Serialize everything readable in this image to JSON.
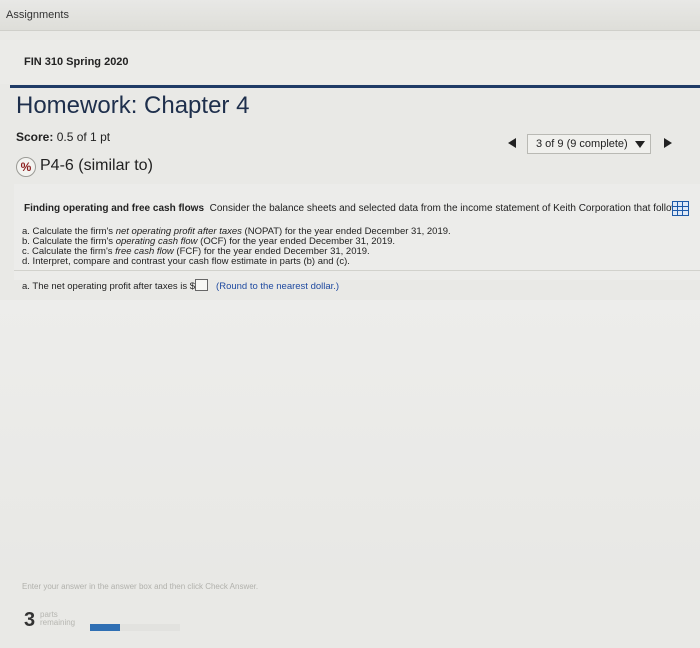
{
  "window": {
    "title": "Assignments"
  },
  "course": {
    "name": "FIN 310 Spring 2020"
  },
  "homework": {
    "title": "Homework: Chapter 4"
  },
  "score": {
    "label": "Score:",
    "value": "0.5 of 1 pt"
  },
  "question_nav": {
    "current": "3 of 9 (9 complete)"
  },
  "problem": {
    "id": "P4-6 (similar to)",
    "status_icon": "partial-credit-icon"
  },
  "question": {
    "heading": "Finding operating and free cash flows",
    "statement": "Consider the balance sheets and selected data from the income statement of Keith Corporation that follow",
    "tasks": [
      {
        "prefix": "a. Calculate the firm's ",
        "term": "net operating profit after taxes",
        "suffix": " (NOPAT) for the year ended December 31, 2019."
      },
      {
        "prefix": "b. Calculate the firm's ",
        "term": "operating cash flow",
        "suffix": " (OCF) for the year ended December 31, 2019."
      },
      {
        "prefix": "c. Calculate the firm's ",
        "term": "free cash flow",
        "suffix": " (FCF) for the year ended December 31, 2019."
      },
      {
        "prefix": "d. Interpret, compare and contrast your cash flow estimate in parts (b) and (c).",
        "term": "",
        "suffix": ""
      }
    ],
    "answer_prompt": "a. The net operating profit after taxes is $",
    "answer_value": "",
    "round_hint": "(Round to the nearest dollar.)"
  },
  "footer": {
    "instruction": "Enter your answer in the answer box and then click Check Answer.",
    "parts_count": "3",
    "parts_label_1": "parts",
    "parts_label_2": "remaining",
    "progress_fraction": 0.33
  },
  "colors": {
    "accent_blue": "#1f3b66",
    "link_blue": "#1f4aa0",
    "progress_blue": "#2f6fb3"
  }
}
